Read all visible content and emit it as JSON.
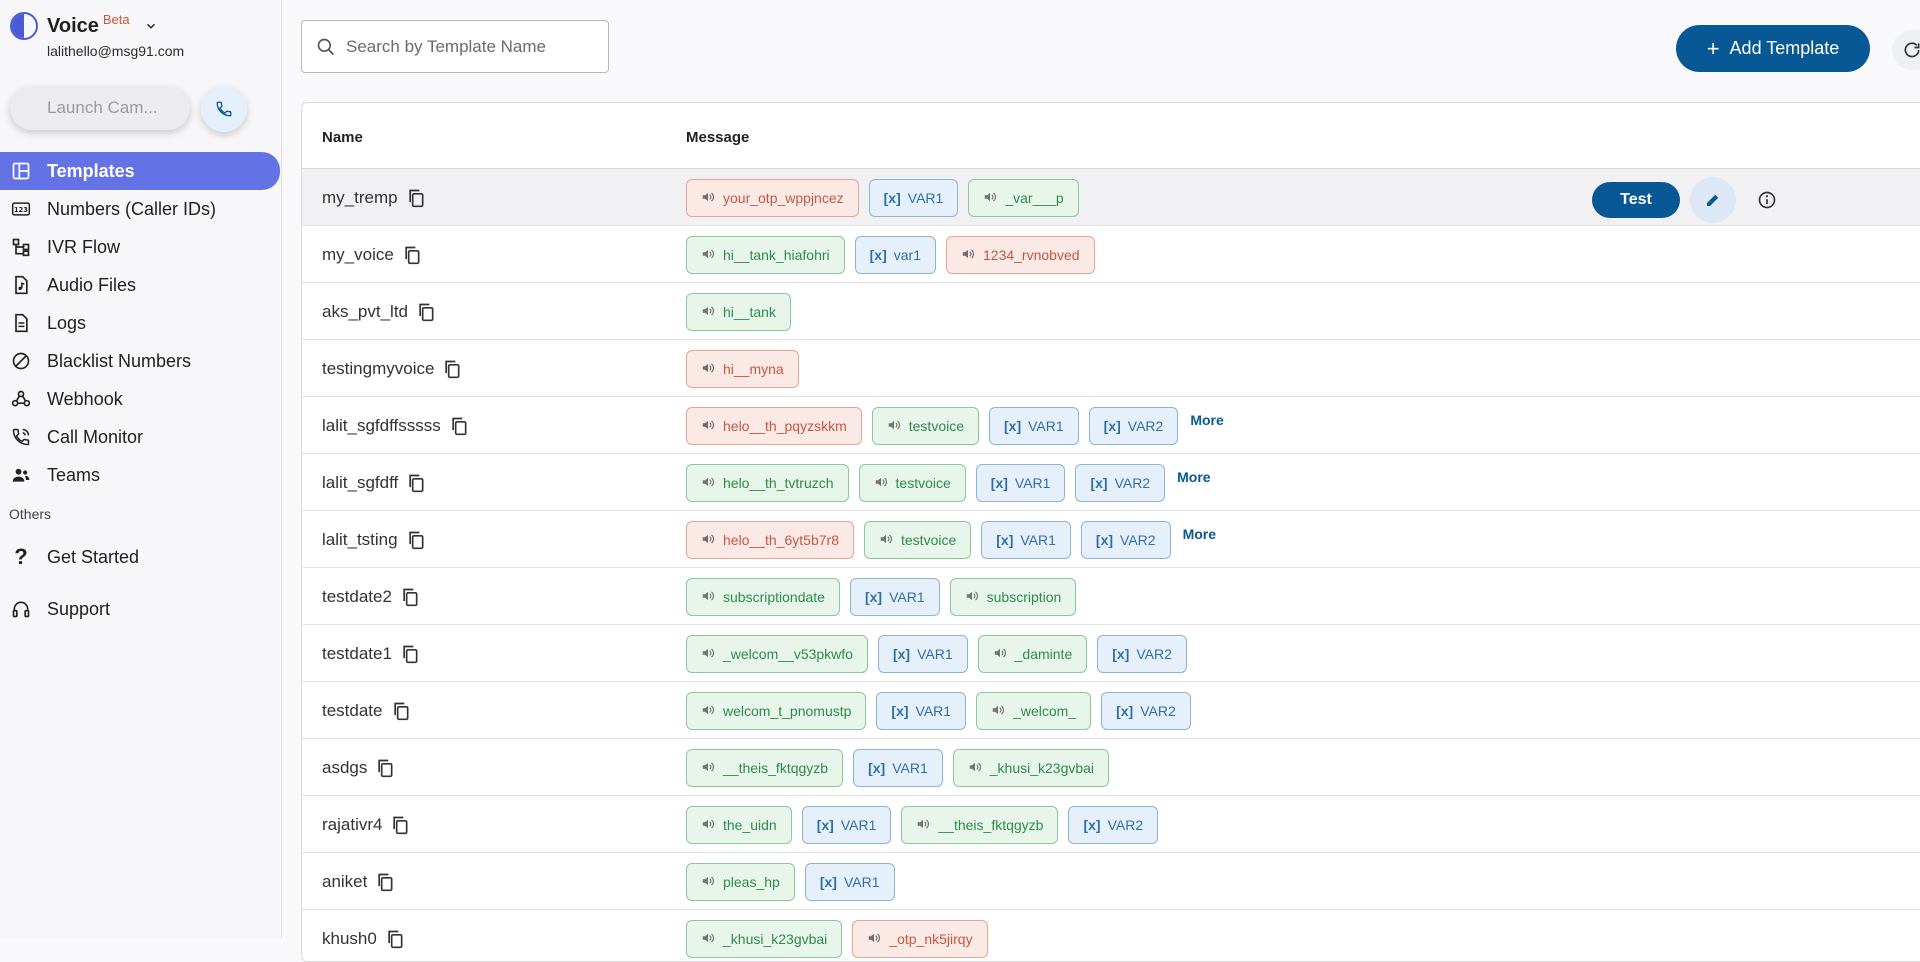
{
  "app": {
    "name": "Voice",
    "badge": "Beta",
    "email": "lalithello@msg91.com"
  },
  "sidebar": {
    "launch_label": "Launch Cam...",
    "items": [
      {
        "label": "Templates",
        "icon": "template-grid-icon",
        "active": true
      },
      {
        "label": "Numbers (Caller IDs)",
        "icon": "number-123-icon"
      },
      {
        "label": "IVR Flow",
        "icon": "flow-tree-icon"
      },
      {
        "label": "Audio Files",
        "icon": "audio-file-icon"
      },
      {
        "label": "Logs",
        "icon": "document-icon"
      },
      {
        "label": "Blacklist Numbers",
        "icon": "block-icon"
      },
      {
        "label": "Webhook",
        "icon": "webhook-icon"
      },
      {
        "label": "Call Monitor",
        "icon": "phone-call-icon"
      },
      {
        "label": "Teams",
        "icon": "people-icon"
      }
    ],
    "section_others": "Others",
    "others": [
      {
        "label": "Get Started",
        "icon": "question-icon"
      },
      {
        "label": "Support",
        "icon": "headset-icon"
      }
    ]
  },
  "search": {
    "placeholder": "Search by Template Name"
  },
  "toolbar": {
    "add_label": "Add Template"
  },
  "table": {
    "headers": {
      "name": "Name",
      "message": "Message"
    },
    "more_label": "More",
    "test_label": "Test",
    "rows": [
      {
        "name": "my_tremp",
        "chips": [
          [
            "red",
            "your_otp_wppjncez"
          ],
          [
            "var",
            "VAR1"
          ],
          [
            "green",
            "_var___p"
          ]
        ]
      },
      {
        "name": "my_voice",
        "chips": [
          [
            "green",
            "hi__tank_hiafohri"
          ],
          [
            "var",
            "var1"
          ],
          [
            "red",
            "1234_rvnobved"
          ]
        ]
      },
      {
        "name": "aks_pvt_ltd",
        "chips": [
          [
            "green",
            "hi__tank"
          ]
        ]
      },
      {
        "name": "testingmyvoice",
        "chips": [
          [
            "red",
            "hi__myna"
          ]
        ]
      },
      {
        "name": "lalit_sgfdffsssss",
        "chips": [
          [
            "red",
            "helo__th_pqyzskkm"
          ],
          [
            "green",
            "testvoice"
          ],
          [
            "var",
            "VAR1"
          ],
          [
            "var",
            "VAR2"
          ]
        ],
        "more": true
      },
      {
        "name": "lalit_sgfdff",
        "chips": [
          [
            "green",
            "helo__th_tvtruzch"
          ],
          [
            "green",
            "testvoice"
          ],
          [
            "var",
            "VAR1"
          ],
          [
            "var",
            "VAR2"
          ]
        ],
        "more": true
      },
      {
        "name": "lalit_tsting",
        "chips": [
          [
            "red",
            "helo__th_6yt5b7r8"
          ],
          [
            "green",
            "testvoice"
          ],
          [
            "var",
            "VAR1"
          ],
          [
            "var",
            "VAR2"
          ]
        ],
        "more": true
      },
      {
        "name": "testdate2",
        "chips": [
          [
            "green",
            "subscriptiondate"
          ],
          [
            "var",
            "VAR1"
          ],
          [
            "green",
            "subscription"
          ]
        ]
      },
      {
        "name": "testdate1",
        "chips": [
          [
            "green",
            "_welcom__v53pkwfo"
          ],
          [
            "var",
            "VAR1"
          ],
          [
            "green",
            "_daminte"
          ],
          [
            "var",
            "VAR2"
          ]
        ]
      },
      {
        "name": "testdate",
        "chips": [
          [
            "green",
            "welcom_t_pnomustp"
          ],
          [
            "var",
            "VAR1"
          ],
          [
            "green",
            "_welcom_"
          ],
          [
            "var",
            "VAR2"
          ]
        ]
      },
      {
        "name": "asdgs",
        "chips": [
          [
            "green",
            "__theis_fktqgyzb"
          ],
          [
            "var",
            "VAR1"
          ],
          [
            "green",
            "_khusi_k23gvbai"
          ]
        ]
      },
      {
        "name": "rajativr4",
        "chips": [
          [
            "green",
            "the_uidn"
          ],
          [
            "var",
            "VAR1"
          ],
          [
            "green",
            "__theis_fktqgyzb"
          ],
          [
            "var",
            "VAR2"
          ]
        ]
      },
      {
        "name": "aniket",
        "chips": [
          [
            "green",
            "pleas_hp"
          ],
          [
            "var",
            "VAR1"
          ]
        ]
      },
      {
        "name": "khush0",
        "chips": [
          [
            "green",
            "_khusi_k23gvbai"
          ],
          [
            "red",
            "_otp_nk5jirqy"
          ]
        ]
      }
    ]
  }
}
